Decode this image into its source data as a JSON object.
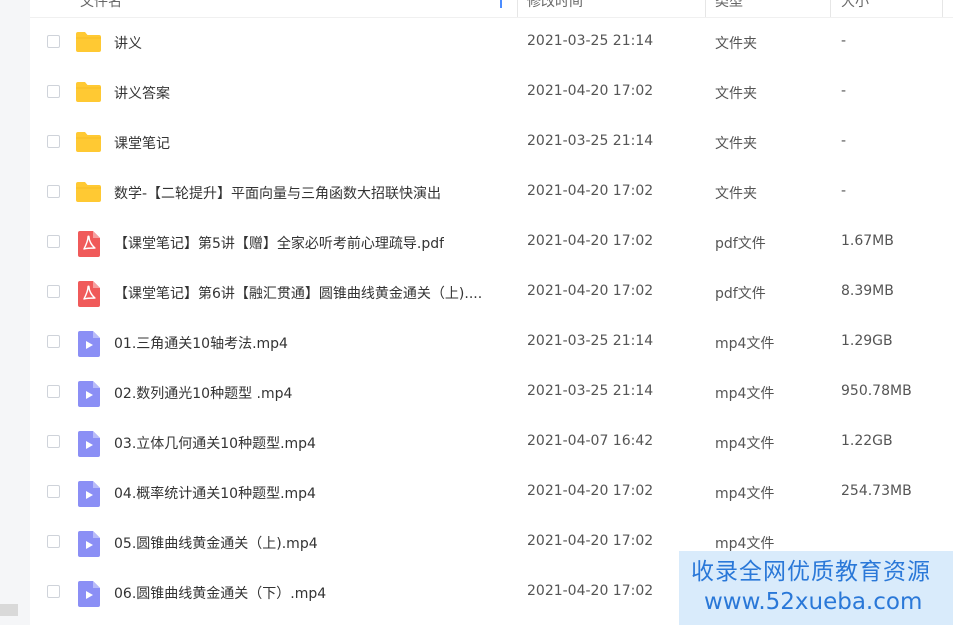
{
  "header": {
    "name": "文件名",
    "time": "修改时间",
    "type": "类型",
    "size": "大小"
  },
  "files": [
    {
      "name": "讲义",
      "time": "2021-03-25 21:14",
      "type": "文件夹",
      "size": "-",
      "icon": "folder-icon"
    },
    {
      "name": "讲义答案",
      "time": "2021-04-20 17:02",
      "type": "文件夹",
      "size": "-",
      "icon": "folder-icon"
    },
    {
      "name": "课堂笔记",
      "time": "2021-03-25 21:14",
      "type": "文件夹",
      "size": "-",
      "icon": "folder-icon"
    },
    {
      "name": "数学-【二轮提升】平面向量与三角函数大招联快演出",
      "time": "2021-04-20 17:02",
      "type": "文件夹",
      "size": "-",
      "icon": "folder-icon"
    },
    {
      "name": "【课堂笔记】第5讲【赠】全家必听考前心理疏导.pdf",
      "time": "2021-04-20 17:02",
      "type": "pdf文件",
      "size": "1.67MB",
      "icon": "pdf-icon"
    },
    {
      "name": "【课堂笔记】第6讲【融汇贯通】圆锥曲线黄金通关（上)....",
      "time": "2021-04-20 17:02",
      "type": "pdf文件",
      "size": "8.39MB",
      "icon": "pdf-icon"
    },
    {
      "name": "01.三角通关10轴考法.mp4",
      "time": "2021-03-25 21:14",
      "type": "mp4文件",
      "size": "1.29GB",
      "icon": "video-icon"
    },
    {
      "name": "02.数列通光10种题型 .mp4",
      "time": "2021-03-25 21:14",
      "type": "mp4文件",
      "size": "950.78MB",
      "icon": "video-icon"
    },
    {
      "name": "03.立体几何通关10种题型.mp4",
      "time": "2021-04-07 16:42",
      "type": "mp4文件",
      "size": "1.22GB",
      "icon": "video-icon"
    },
    {
      "name": "04.概率统计通关10种题型.mp4",
      "time": "2021-04-20 17:02",
      "type": "mp4文件",
      "size": "254.73MB",
      "icon": "video-icon"
    },
    {
      "name": "05.圆锥曲线黄金通关（上).mp4",
      "time": "2021-04-20 17:02",
      "type": "mp4文件",
      "size": "",
      "icon": "video-icon"
    },
    {
      "name": "06.圆锥曲线黄金通关（下）.mp4",
      "time": "2021-04-20 17:02",
      "type": "",
      "size": "",
      "icon": "video-icon"
    }
  ],
  "watermark": {
    "line1": "收录全网优质教育资源",
    "line2": "www.52xueba.com"
  },
  "colors": {
    "folder": "#ffc933",
    "pdf": "#f05a5a",
    "video": "#8b8ff5",
    "watermark_text": "#2a78d8"
  }
}
